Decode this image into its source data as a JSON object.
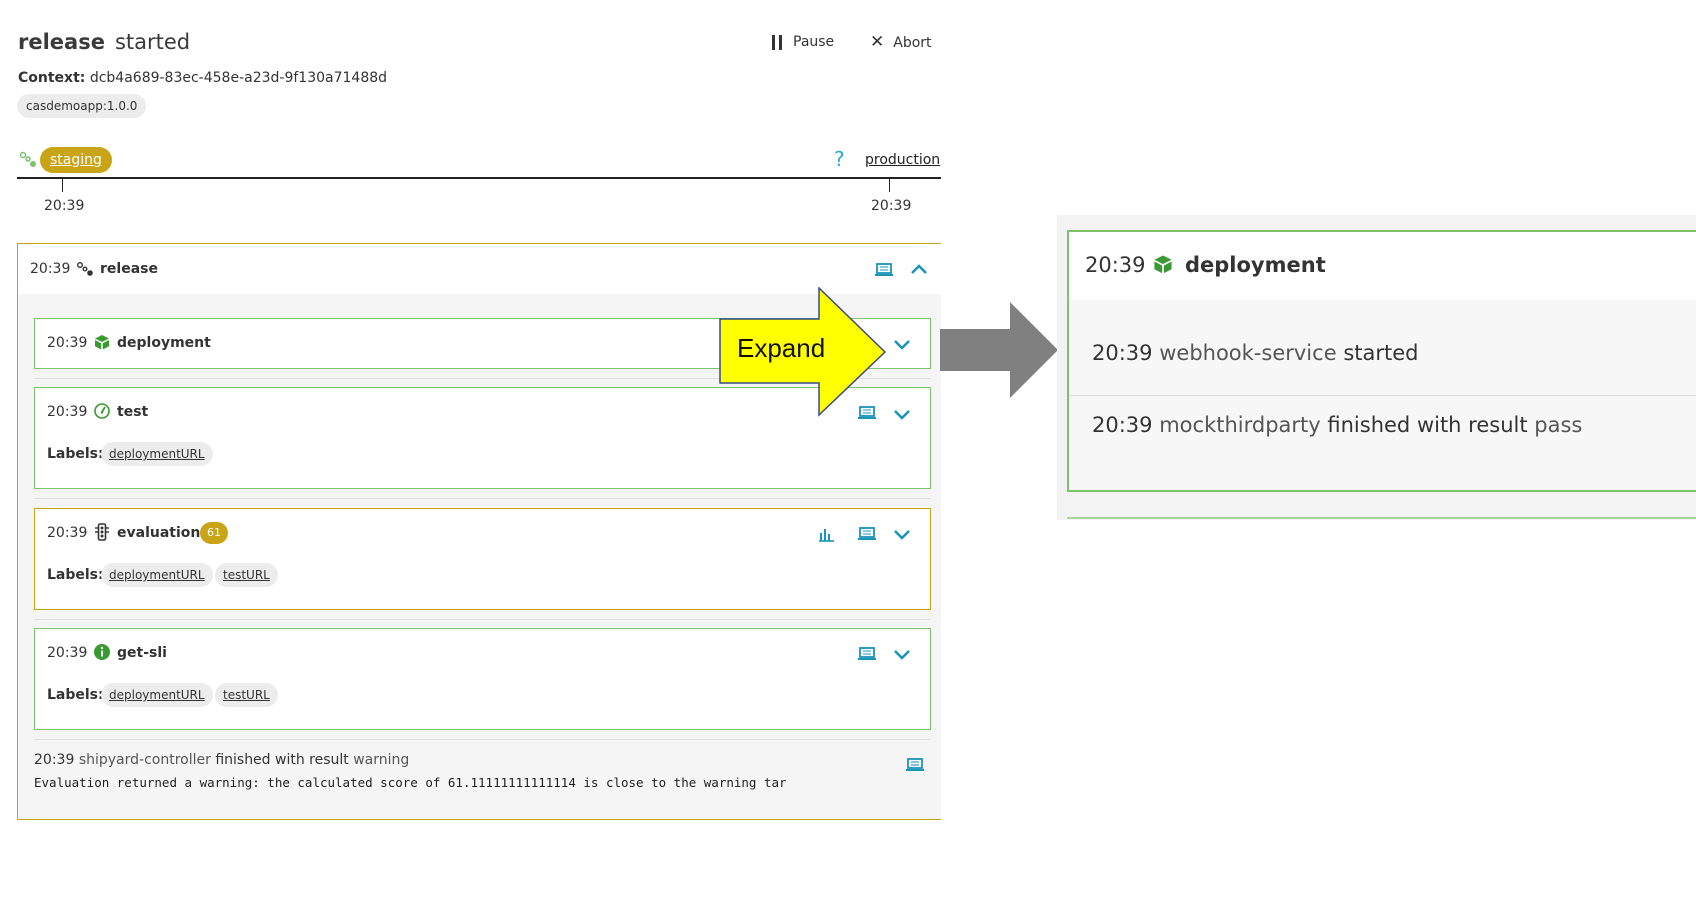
{
  "header": {
    "sequence_name": "release",
    "status": "started",
    "pause_label": "Pause",
    "abort_label": "Abort",
    "context_label": "Context:",
    "context_id": "dcb4a689-83ec-458e-a23d-9f130a71488d",
    "artifact": "casdemoapp:1.0.0"
  },
  "timeline": {
    "stage_current": "staging",
    "stage_next": "production",
    "help_glyph": "?",
    "time_left": "20:39",
    "time_right": "20:39"
  },
  "sequence": {
    "time": "20:39",
    "name": "release",
    "tasks": [
      {
        "time": "20:39",
        "name": "deployment",
        "icon": "deployment-box-icon"
      },
      {
        "time": "20:39",
        "name": "test",
        "icon": "test-gauge-icon",
        "labels_title": "Labels:",
        "labels": [
          "deploymentURL"
        ]
      },
      {
        "time": "20:39",
        "name": "evaluation",
        "icon": "traffic-light-icon",
        "score": "61",
        "labels_title": "Labels:",
        "labels": [
          "deploymentURL",
          "testURL"
        ]
      },
      {
        "time": "20:39",
        "name": "get-sli",
        "icon": "info-icon",
        "labels_title": "Labels:",
        "labels": [
          "deploymentURL",
          "testURL"
        ]
      }
    ],
    "final_event": {
      "time": "20:39",
      "source": "shipyard-controller",
      "text": "finished with result",
      "result": "warning",
      "message": "Evaluation returned a warning: the calculated score of 61.11111111111114 is close to the warning tar"
    }
  },
  "callout": {
    "text": "Expand"
  },
  "zoom": {
    "time": "20:39",
    "name": "deployment",
    "events": [
      {
        "time": "20:39",
        "source": "webhook-service",
        "text": "started",
        "result": ""
      },
      {
        "time": "20:39",
        "source": "mockthirdparty",
        "text": "finished with result",
        "result": "pass"
      }
    ]
  },
  "colors": {
    "accent_yellow": "#c9a417",
    "success_green": "#7ec26b",
    "icon_teal": "#1a94b8",
    "callout_yellow": "#ffff00",
    "arrow_gray": "#808080"
  }
}
